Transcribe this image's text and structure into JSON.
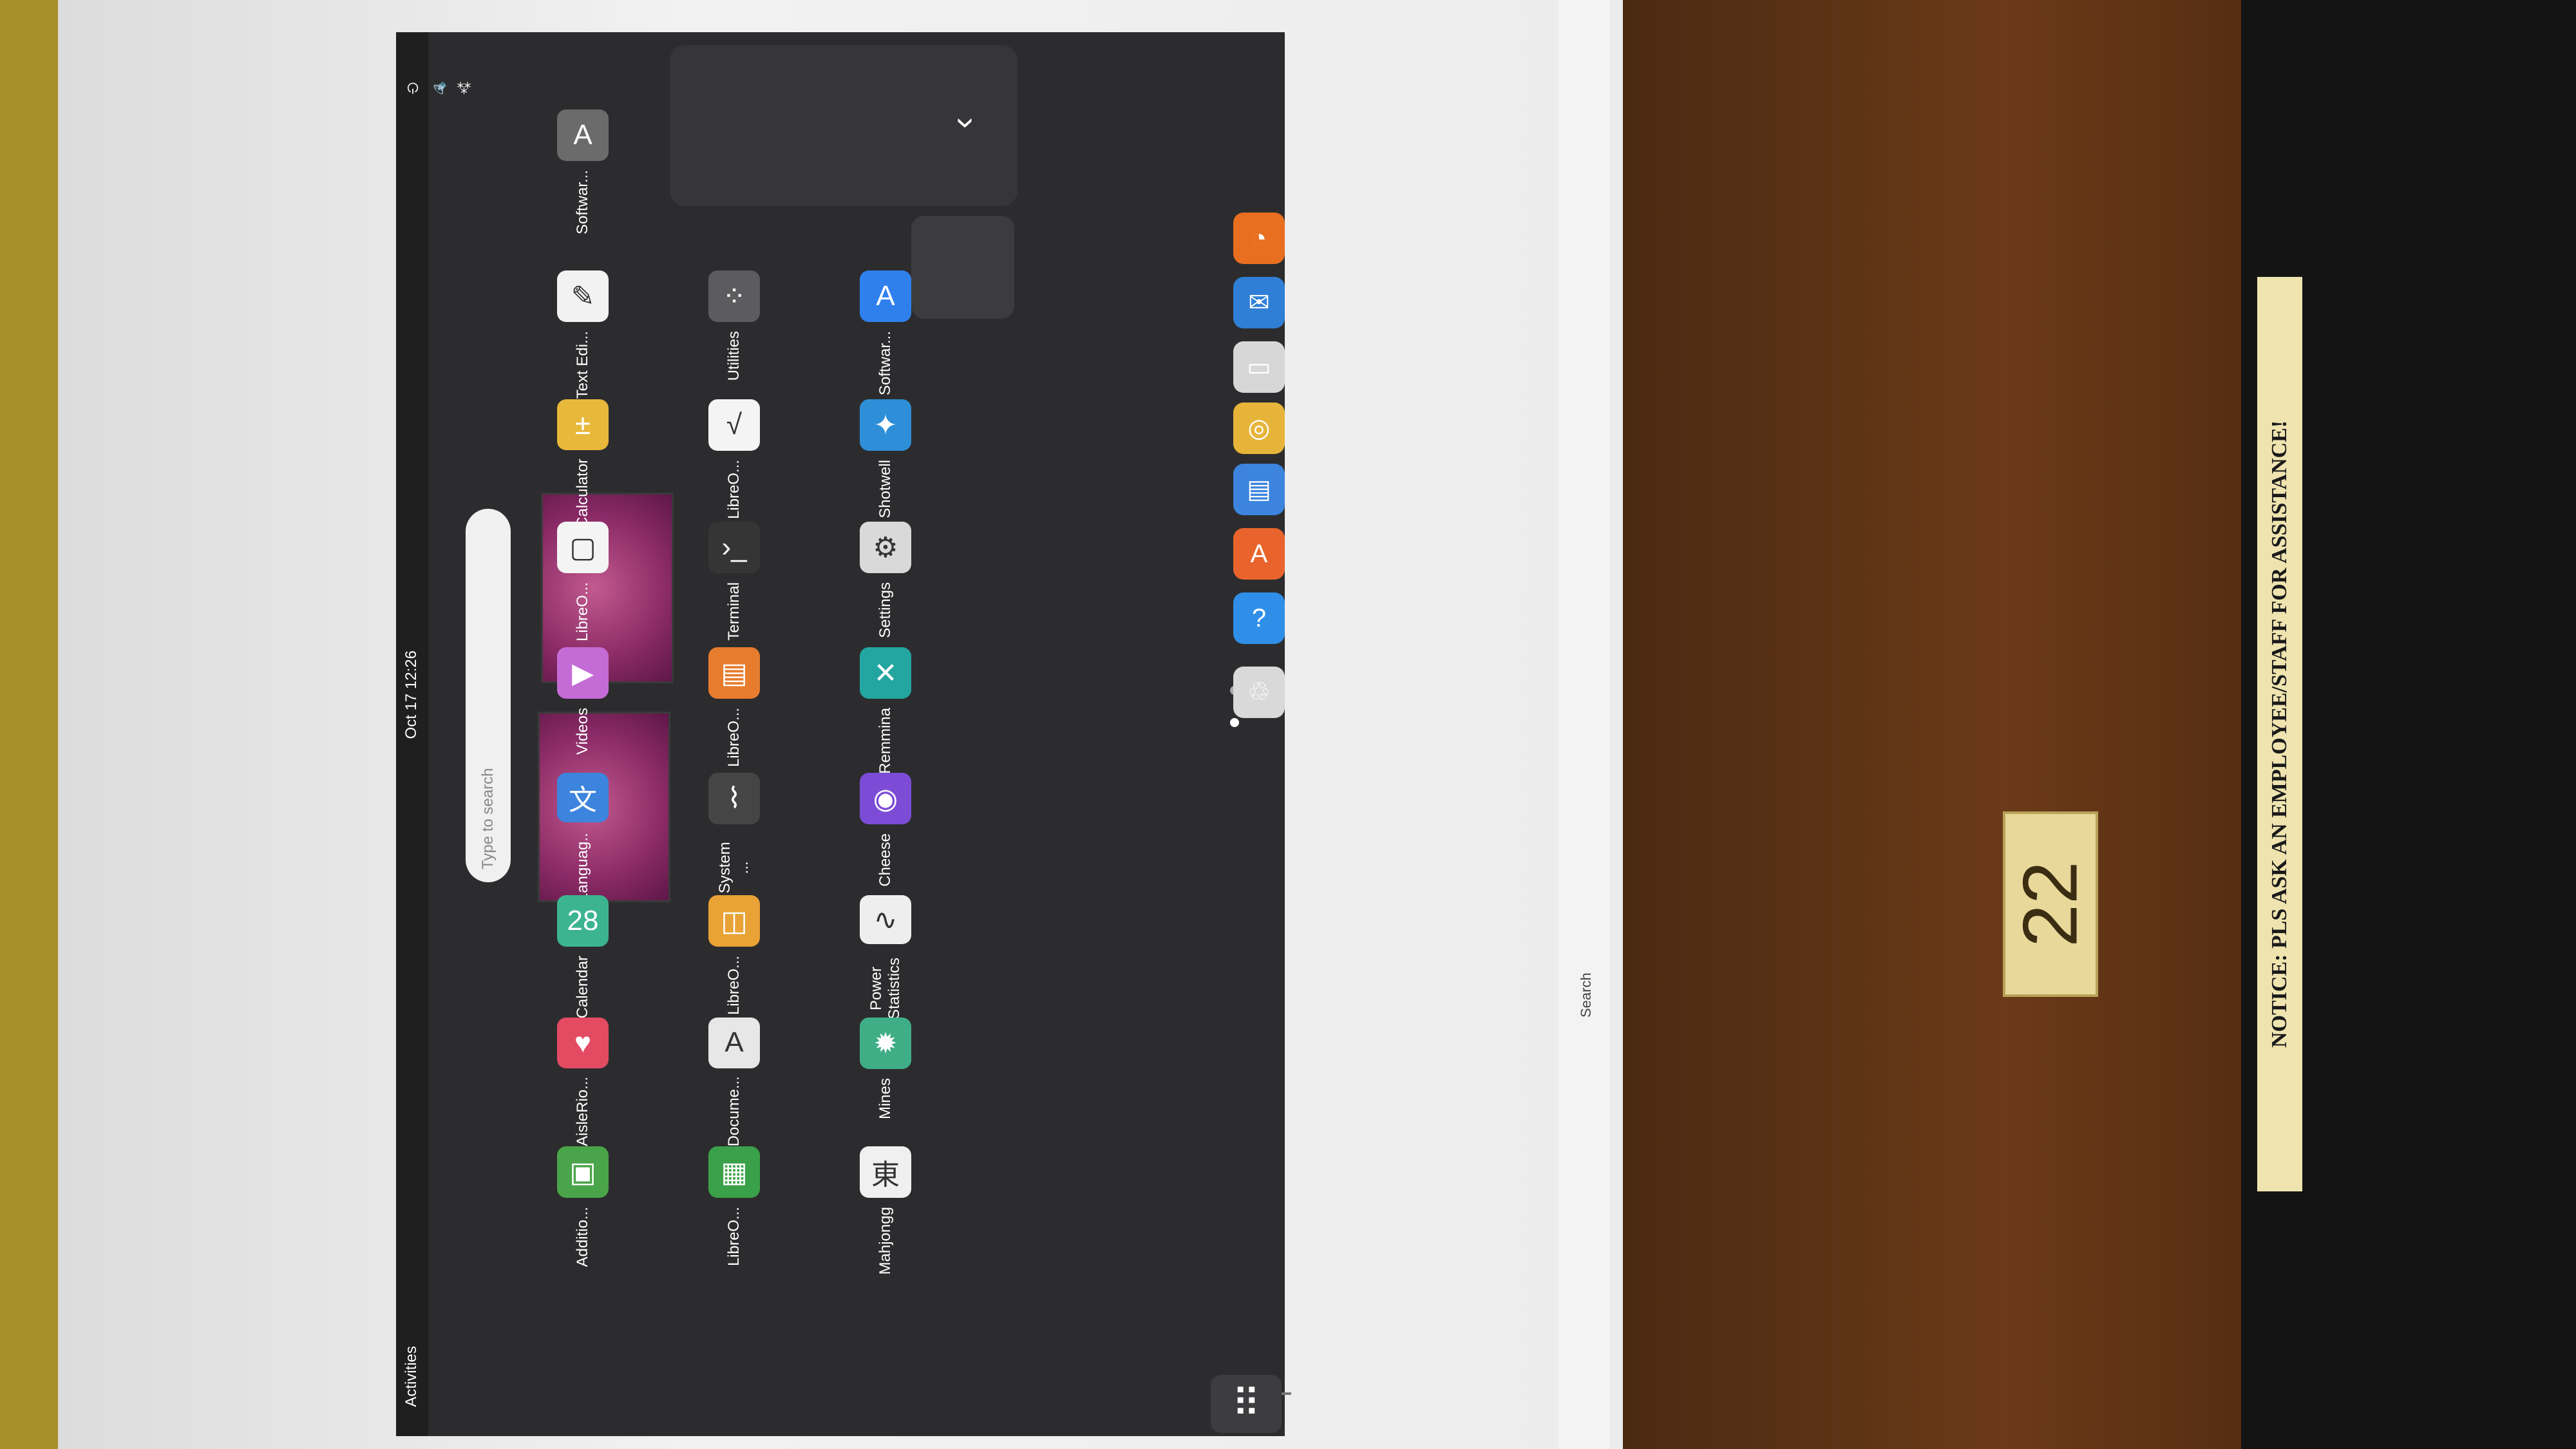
{
  "topbar": {
    "activities": "Activities",
    "clock": "Oct 17  12:26",
    "status_icons": [
      "network-icon",
      "volume-icon",
      "power-icon"
    ]
  },
  "search": {
    "placeholder": "Type to search"
  },
  "apps": [
    {
      "label": "Softwar...",
      "icon": "software-updater-icon",
      "color": "#6b6b6b"
    },
    {
      "label": "Text Edi...",
      "icon": "text-editor-icon",
      "color": "#f2f2f2"
    },
    {
      "label": "Calculator",
      "icon": "calculator-icon",
      "color": "#e8b83a"
    },
    {
      "label": "LibreO...",
      "icon": "libreoffice-icon",
      "color": "#f4f4f4"
    },
    {
      "label": "Videos",
      "icon": "videos-icon",
      "color": "#c56bd6"
    },
    {
      "label": "Languag...",
      "icon": "language-icon",
      "color": "#3c84de"
    },
    {
      "label": "Calendar",
      "icon": "calendar-icon",
      "color": "#3db490"
    },
    {
      "label": "AisleRio...",
      "icon": "aisleriot-icon",
      "color": "#e34b63"
    },
    {
      "label": "Additio...",
      "icon": "additional-drivers-icon",
      "color": "#4aa449"
    },
    {
      "label": "Utilities",
      "icon": "utilities-folder-icon",
      "color": "#5c5c5e"
    },
    {
      "label": "LibreO...",
      "icon": "libreoffice-math-icon",
      "color": "#f4f4f4"
    },
    {
      "label": "Terminal",
      "icon": "terminal-icon",
      "color": "#353535"
    },
    {
      "label": "LibreO...",
      "icon": "libreoffice-impress-icon",
      "color": "#e77c2e"
    },
    {
      "label": "System ...",
      "icon": "system-monitor-icon",
      "color": "#454545"
    },
    {
      "label": "LibreO...",
      "icon": "libreoffice-draw-icon",
      "color": "#e8a235"
    },
    {
      "label": "Docume...",
      "icon": "document-viewer-icon",
      "color": "#e7e7e7"
    },
    {
      "label": "LibreO...",
      "icon": "libreoffice-calc-icon",
      "color": "#3aa14a"
    },
    {
      "label": "Softwar...",
      "icon": "software-icon",
      "color": "#2f80ed"
    },
    {
      "label": "Shotwell",
      "icon": "shotwell-icon",
      "color": "#2e8fd8"
    },
    {
      "label": "Settings",
      "icon": "settings-icon",
      "color": "#d9d9d9"
    },
    {
      "label": "Remmina",
      "icon": "remmina-icon",
      "color": "#23a5a0"
    },
    {
      "label": "Cheese",
      "icon": "cheese-icon",
      "color": "#7c4cd6"
    },
    {
      "label": "Power Statistics",
      "icon": "power-statistics-icon",
      "color": "#eeeeee"
    },
    {
      "label": "Mines",
      "icon": "mines-icon",
      "color": "#3fae86"
    },
    {
      "label": "Mahjongg",
      "icon": "mahjongg-icon",
      "color": "#f0f0f0"
    }
  ],
  "dock": [
    {
      "icon": "firefox-icon",
      "color": "#e76f1f"
    },
    {
      "icon": "thunderbird-icon",
      "color": "#2f7fd6"
    },
    {
      "icon": "files-icon",
      "color": "#d7d7d7"
    },
    {
      "icon": "rhythmbox-icon",
      "color": "#e7b43a"
    },
    {
      "icon": "libreoffice-writer-icon",
      "color": "#3c84de"
    },
    {
      "icon": "software-center-icon",
      "color": "#e8642c"
    },
    {
      "icon": "help-icon",
      "color": "#2f8fe8"
    },
    {
      "icon": "trash-icon",
      "color": "#d9d9d9"
    }
  ],
  "notice_text": "NOTICE: PLS ASK AN EMPLOYEE/STAFF FOR ASSISTANCE!",
  "station_number": "22",
  "windows_search": "Search"
}
